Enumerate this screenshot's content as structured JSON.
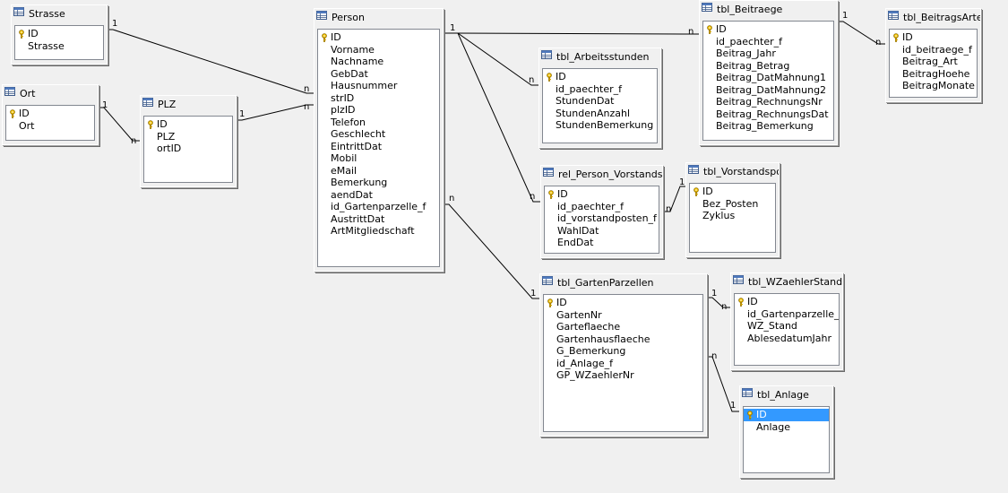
{
  "tables": [
    {
      "id": "strasse",
      "name": "Strasse",
      "fields": [
        "ID",
        "Strasse"
      ],
      "primary_keys": [
        "ID"
      ]
    },
    {
      "id": "ort",
      "name": "Ort",
      "fields": [
        "ID",
        "Ort"
      ],
      "primary_keys": [
        "ID"
      ]
    },
    {
      "id": "plz",
      "name": "PLZ",
      "fields": [
        "ID",
        "PLZ",
        "ortID"
      ],
      "primary_keys": [
        "ID"
      ]
    },
    {
      "id": "person",
      "name": "Person",
      "fields": [
        "ID",
        "Vorname",
        "Nachname",
        "GebDat",
        "Hausnummer",
        "strID",
        "plzID",
        "Telefon",
        "Geschlecht",
        "EintrittDat",
        "Mobil",
        "eMail",
        "Bemerkung",
        "aendDat",
        "id_Gartenparzelle_f",
        "AustrittDat",
        "ArtMitgliedschaft"
      ],
      "primary_keys": [
        "ID"
      ]
    },
    {
      "id": "arbeitsstunden",
      "name": "tbl_Arbeitsstunden",
      "fields": [
        "ID",
        "id_paechter_f",
        "StundenDat",
        "StundenAnzahl",
        "StundenBemerkung"
      ],
      "primary_keys": [
        "ID"
      ]
    },
    {
      "id": "beitraege",
      "name": "tbl_Beitraege",
      "fields": [
        "ID",
        "id_paechter_f",
        "Beitrag_Jahr",
        "Beitrag_Betrag",
        "Beitrag_DatMahnung1",
        "Beitrag_DatMahnung2",
        "Beitrag_RechnungsNr",
        "Beitrag_RechnungsDat",
        "Beitrag_Bemerkung"
      ],
      "primary_keys": [
        "ID"
      ]
    },
    {
      "id": "beitragsarten",
      "name": "tbl_BeitragsArten",
      "fields": [
        "ID",
        "id_beitraege_f",
        "Beitrag_Art",
        "BeitragHoehe",
        "BeitragMonate"
      ],
      "primary_keys": [
        "ID"
      ]
    },
    {
      "id": "relperson",
      "name": "rel_Person_Vorstandspc",
      "fields": [
        "ID",
        "id_paechter_f",
        "id_vorstandposten_f",
        "WahlDat",
        "EndDat"
      ],
      "primary_keys": [
        "ID"
      ]
    },
    {
      "id": "vorstandspos",
      "name": "tbl_Vorstandspos",
      "fields": [
        "ID",
        "Bez_Posten",
        "Zyklus"
      ],
      "primary_keys": [
        "ID"
      ]
    },
    {
      "id": "gartenparzellen",
      "name": "tbl_GartenParzellen",
      "fields": [
        "ID",
        "GartenNr",
        "Garteflaeche",
        "Gartenhausflaeche",
        "G_Bemerkung",
        "id_Anlage_f",
        "GP_WZaehlerNr"
      ],
      "primary_keys": [
        "ID"
      ]
    },
    {
      "id": "wzaehler",
      "name": "tbl_WZaehlerStand",
      "fields": [
        "ID",
        "id_Gartenparzelle_f",
        "WZ_Stand",
        "AblesedatumJahr"
      ],
      "primary_keys": [
        "ID"
      ]
    },
    {
      "id": "anlage",
      "name": "tbl_Anlage",
      "fields": [
        "ID",
        "Anlage"
      ],
      "primary_keys": [
        "ID"
      ],
      "selected_field": "ID"
    }
  ],
  "relations": [
    {
      "from": "strasse",
      "to": "person",
      "from_card": "1",
      "to_card": "n"
    },
    {
      "from": "ort",
      "to": "plz",
      "from_card": "1",
      "to_card": "n"
    },
    {
      "from": "plz",
      "to": "person",
      "from_card": "1",
      "to_card": "n"
    },
    {
      "from": "person",
      "to": "beitraege",
      "from_card": "1",
      "to_card": "n"
    },
    {
      "from": "person",
      "to": "arbeitsstunden",
      "from_card": "",
      "to_card": "n"
    },
    {
      "from": "person",
      "to": "relperson",
      "from_card": "",
      "to_card": "n"
    },
    {
      "from": "beitraege",
      "to": "beitragsarten",
      "from_card": "1",
      "to_card": "n"
    },
    {
      "from": "vorstandspos",
      "to": "relperson",
      "from_card": "1",
      "to_card": "n"
    },
    {
      "from": "person",
      "to": "gartenparzellen",
      "from_card": "n",
      "to_card": "1"
    },
    {
      "from": "gartenparzellen",
      "to": "wzaehler",
      "from_card": "1",
      "to_card": "n"
    },
    {
      "from": "gartenparzellen",
      "to": "anlage",
      "from_card": "n",
      "to_card": "1"
    }
  ],
  "icons": {
    "table": "table-icon",
    "primary_key": "key-icon"
  },
  "colors": {
    "background": "#f0f0f0",
    "list_background": "#ffffff",
    "selection": "#3399ff",
    "line": "#000000",
    "key": "#e8b400"
  }
}
